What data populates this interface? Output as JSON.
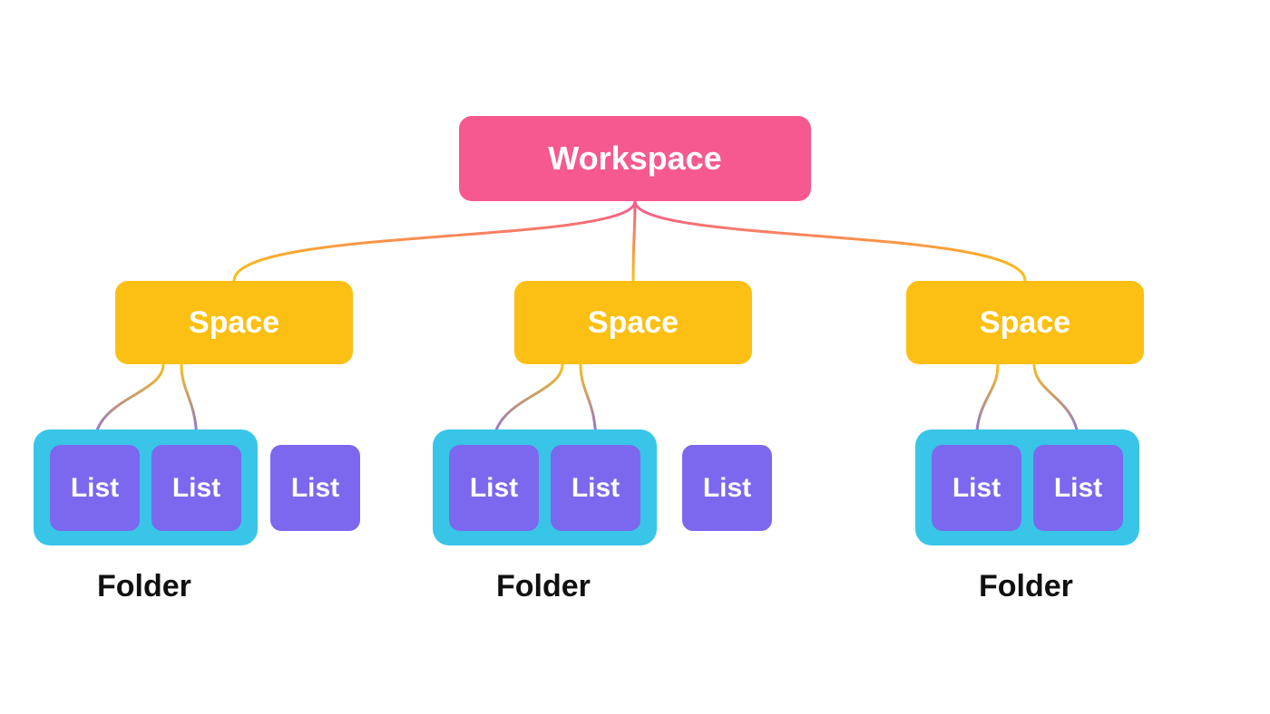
{
  "hierarchy": {
    "root": {
      "label": "Workspace",
      "color": "#f6598f"
    },
    "spaces": [
      {
        "label": "Space",
        "color": "#fcc014"
      },
      {
        "label": "Space",
        "color": "#fcc014"
      },
      {
        "label": "Space",
        "color": "#fcc014"
      }
    ],
    "folders": [
      {
        "label": "Folder",
        "color": "#38c5e8",
        "lists_inside": [
          {
            "label": "List",
            "color": "#7b68ee"
          },
          {
            "label": "List",
            "color": "#7b68ee"
          }
        ],
        "lists_outside": [
          {
            "label": "List",
            "color": "#7b68ee"
          }
        ]
      },
      {
        "label": "Folder",
        "color": "#38c5e8",
        "lists_inside": [
          {
            "label": "List",
            "color": "#7b68ee"
          },
          {
            "label": "List",
            "color": "#7b68ee"
          }
        ],
        "lists_outside": [
          {
            "label": "List",
            "color": "#7b68ee"
          }
        ]
      },
      {
        "label": "Folder",
        "color": "#38c5e8",
        "lists_inside": [
          {
            "label": "List",
            "color": "#7b68ee"
          },
          {
            "label": "List",
            "color": "#7b68ee"
          }
        ],
        "lists_outside": []
      }
    ]
  },
  "colors": {
    "workspace": "#f6598f",
    "space": "#fcc014",
    "folder": "#38c5e8",
    "list": "#7b68ee",
    "background": "#ffffff",
    "text_light": "#ffffff",
    "text_dark": "#101010"
  }
}
